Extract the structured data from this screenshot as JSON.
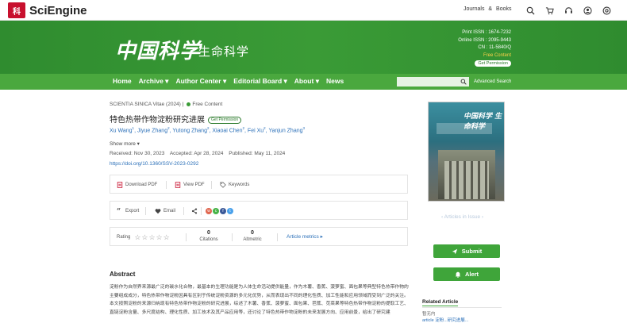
{
  "header": {
    "logo_mark": "科",
    "logo_text": "SciEngine",
    "links": [
      "Journals",
      "&",
      "Books"
    ],
    "icons": [
      "search-icon",
      "cart-icon",
      "headset-icon",
      "user-icon",
      "settings-icon"
    ]
  },
  "banner": {
    "title": "中国科学",
    "subtitle": "生命科学",
    "print_issn": "Print ISSN : 1674-7232",
    "online_issn": "Online ISSN : 2095-9443",
    "cn": "CN : 11-5840/Q",
    "free_content": "Free Content",
    "get_permission": "Get Permission"
  },
  "nav": {
    "items": [
      "Home",
      "Archive ▾",
      "Author Center ▾",
      "Editorial Board ▾",
      "About ▾",
      "News"
    ],
    "search_placeholder": "",
    "advanced_search": "Advanced Search"
  },
  "article": {
    "journal": "SCIENTIA SINICA Vitae (2024) |",
    "free": "Free Content",
    "title": "特色热带作物淀粉研究进展",
    "permission": "Get Permission",
    "authors": [
      {
        "name": "Xu Wang",
        "sup": "1"
      },
      {
        "name": "Jiyue Zhang",
        "sup": "2"
      },
      {
        "name": "Yutong Zhang",
        "sup": "2"
      },
      {
        "name": "Xiaoai Chen",
        "sup": "2"
      },
      {
        "name": "Fei Xu",
        "sup": "2"
      },
      {
        "name": "Yanjun Zhang",
        "sup": "3"
      }
    ],
    "show_more": "Show more ▾",
    "received": "Received: Nov 30, 2023",
    "accepted": "Accepted: Apr 28, 2024",
    "published": "Published: May 11, 2024",
    "doi": "https://doi.org/10.1360/SSV-2023-0292"
  },
  "actions": {
    "download_pdf": "Download PDF",
    "view_pdf": "View PDF",
    "keywords": "Keywords",
    "export": "Export",
    "email": "Email",
    "rating": "Rating",
    "stars": "☆☆☆☆☆",
    "citations_value": "0",
    "citations": "Citations",
    "altmetric_value": "0",
    "altmetric": "Altmetric",
    "article_metrics": "Article metrics ▸"
  },
  "abstract": {
    "heading": "Abstract",
    "text": "淀粉作为自然界来源最广泛的碳水化合物，最基本的生理功能是为人体生命活动提供能量，作为木薯、香蕉、菠萝蜜、面包果等典型特色热带作物的主要组成成分，特色热带作物淀粉因具有区别于传统淀粉资源的多元化优势，从而表现出不同的理化性质、加工性能和应用领域而受到广泛的关注。本文按照淀粉的来源归纳现有特色热带作物淀粉的研究进展，综述了木薯、香蕉、菠萝蜜、面包果、芭蕉、苋菜果等特色热带作物淀粉的提取工艺、直链淀粉含量、多尺度结构、理化性质、加工技术及其产品应用等，还讨论了特色热带作物淀粉的未来发展方向、应用前景，给出了研究建"
  },
  "sidebar": {
    "cover_title": "中国科学 生命科学",
    "articles_in_issue": "‹  Articles in Issue  ›",
    "submit": "Submit",
    "alert": "Alert",
    "related_heading": "Related Article",
    "related_item": "暂无内",
    "related_item2": "article 淀粉...研究进展..."
  },
  "colors": {
    "brand_green": "#3a9b36",
    "link_blue": "#2a6fb8",
    "logo_red": "#c8102e"
  }
}
